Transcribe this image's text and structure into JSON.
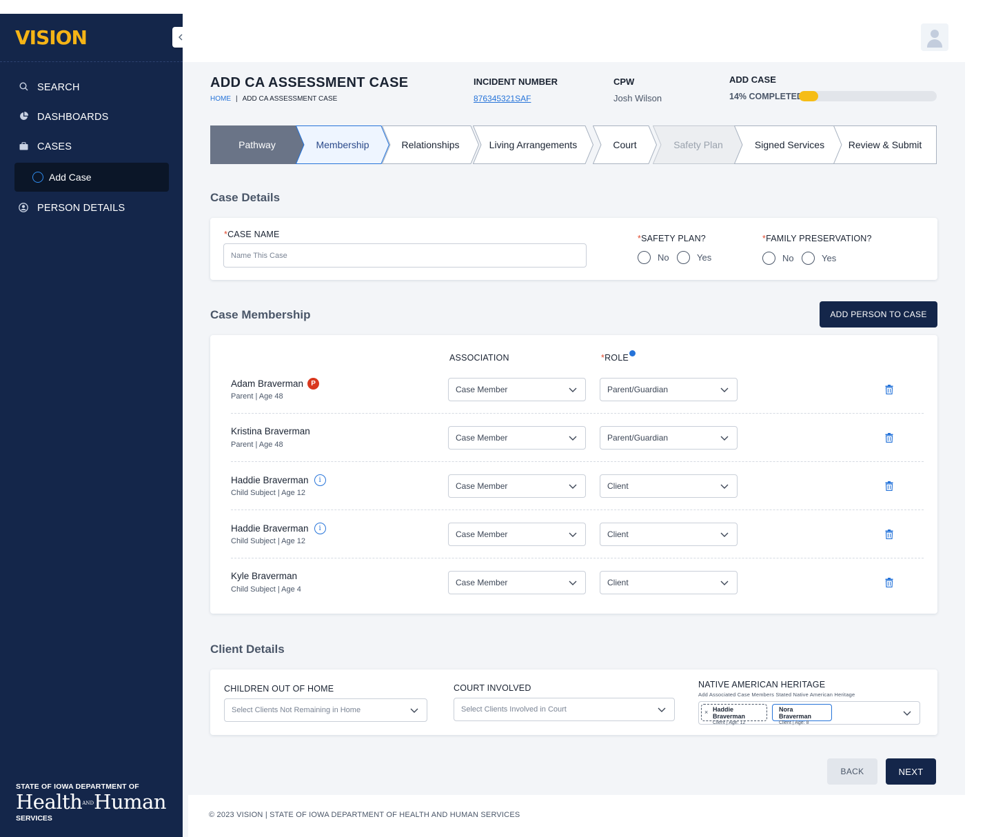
{
  "app": {
    "logo": "VISION"
  },
  "sidebar": {
    "items": [
      {
        "label": "SEARCH"
      },
      {
        "label": "DASHBOARDS"
      },
      {
        "label": "CASES"
      },
      {
        "label": "PERSON DETAILS"
      }
    ],
    "sub_item": {
      "label": "Add Case"
    },
    "org": {
      "line1": "STATE OF IOWA DEPARTMENT OF",
      "line2a": "Health",
      "line2and": "AND",
      "line2b": "Human",
      "line3": "SERVICES"
    }
  },
  "header": {
    "title": "ADD CA ASSESSMENT CASE",
    "breadcrumb": {
      "home": "HOME",
      "current": "ADD CA ASSESSMENT CASE"
    },
    "incident": {
      "label": "INCIDENT NUMBER",
      "value": "876345321SAF"
    },
    "cpw": {
      "label": "CPW",
      "value": "Josh Wilson"
    },
    "progress": {
      "label": "ADD CASE",
      "text": "14% COMPLETED",
      "percent": 14
    }
  },
  "stepper": {
    "steps": [
      {
        "label": "Pathway",
        "state": "completed"
      },
      {
        "label": "Membership",
        "state": "active"
      },
      {
        "label": "Relationships",
        "state": "default"
      },
      {
        "label": "Living Arrangements",
        "state": "default"
      },
      {
        "label": "Court",
        "state": "default"
      },
      {
        "label": "Safety Plan",
        "state": "disabled"
      },
      {
        "label": "Signed Services",
        "state": "default"
      },
      {
        "label": "Review & Submit",
        "state": "default"
      }
    ]
  },
  "case_details": {
    "title": "Case Details",
    "case_name": {
      "label": "CASE NAME",
      "placeholder": "Name This Case"
    },
    "safety_plan": {
      "label": "SAFETY PLAN?",
      "options": [
        "No",
        "Yes"
      ]
    },
    "family_preservation": {
      "label": "FAMILY PRESERVATION?",
      "options": [
        "No",
        "Yes"
      ]
    }
  },
  "membership": {
    "title": "Case Membership",
    "add_button": "ADD PERSON TO CASE",
    "col_association": "ASSOCIATION",
    "col_role": "ROLE",
    "members": [
      {
        "name": "Adam Braverman",
        "sub": "Parent | Age 48",
        "badge": "P",
        "association": "Case Member",
        "role": "Parent/Guardian"
      },
      {
        "name": "Kristina Braverman",
        "sub": "Parent | Age 48",
        "badge": "",
        "association": "Case Member",
        "role": "Parent/Guardian"
      },
      {
        "name": "Haddie Braverman",
        "sub": "Child Subject | Age 12",
        "badge": "i",
        "association": "Case Member",
        "role": "Client"
      },
      {
        "name": "Haddie Braverman",
        "sub": "Child Subject | Age 12",
        "badge": "i",
        "association": "Case Member",
        "role": "Client"
      },
      {
        "name": "Kyle Braverman",
        "sub": "Child Subject | Age 4",
        "badge": "",
        "association": "Case Member",
        "role": "Client"
      }
    ]
  },
  "client_details": {
    "title": "Client Details",
    "children_out": {
      "label": "CHILDREN OUT OF HOME",
      "placeholder": "Select Clients Not Remaining in Home"
    },
    "court": {
      "label": "COURT INVOLVED",
      "placeholder": "Select Clients Involved in Court"
    },
    "heritage": {
      "label": "NATIVE AMERICAN HERITAGE",
      "sublabel": "Add Associated Case Members Stated Native American Heritage",
      "chips": [
        {
          "name": "Haddie Braverman",
          "sub": "Client | Age: 12"
        },
        {
          "name": "Nora Braverman",
          "sub": "Client | Age: 8"
        }
      ]
    }
  },
  "actions": {
    "back": "BACK",
    "next": "NEXT"
  },
  "footer": {
    "text": "©  2023 VISION | STATE OF IOWA DEPARTMENT OF HEALTH AND HUMAN SERVICES"
  },
  "colors": {
    "navy": "#14264a",
    "accent": "#2573d9",
    "progress": "#f6bd16",
    "required": "#e04a2f"
  }
}
